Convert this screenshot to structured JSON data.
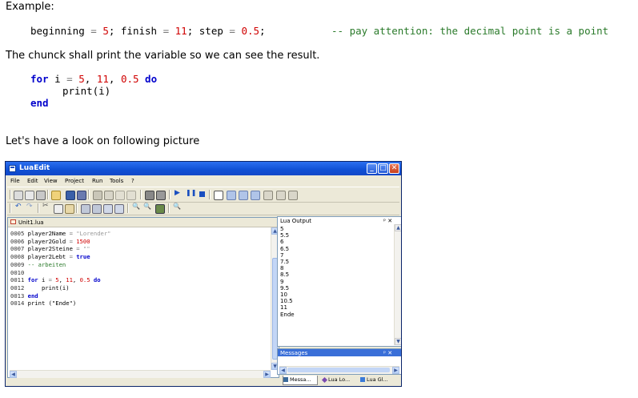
{
  "doc": {
    "example_heading": "Example:",
    "line1": {
      "code_pre1": "beginning ",
      "op1": "=",
      "code_pre2": " ",
      "num1": "5",
      "sep1": "; finish ",
      "op2": "=",
      "sp2": " ",
      "num2": "11",
      "sep2": "; step ",
      "op3": "=",
      "sp3": " ",
      "num3": "0.5",
      "end": ";"
    },
    "line1_comment": "-- pay attention: the decimal point is a point",
    "para": "The chunck shall print the variable so we can see the result.",
    "for_kw": "for",
    "for_var": " i ",
    "for_op": "=",
    "for_sp": " ",
    "for_n1": "5",
    "for_c1": ", ",
    "for_n2": "11",
    "for_c2": ", ",
    "for_n3": "0.5",
    "for_sp2": " ",
    "do_kw": "do",
    "print_line": "print(i)",
    "end_kw": "end",
    "picture_para": "Let's have a look on following picture"
  },
  "window": {
    "title": "LuaEdit",
    "buttons": {
      "min": "_",
      "max": "□",
      "close": "✕"
    },
    "menu": [
      "File",
      "Edit",
      "View",
      "Project",
      "Run",
      "Tools",
      "?"
    ],
    "editor_tab": "Unit1.lua",
    "code": [
      {
        "n": "0005",
        "a": " player2Name ",
        "o": "=",
        "s": " ",
        "v": "\"Lorender\"",
        "t": "str"
      },
      {
        "n": "0006",
        "a": " player2Gold ",
        "o": "=",
        "s": " ",
        "v": "1500",
        "t": "num"
      },
      {
        "n": "0007",
        "a": " player2Steine ",
        "o": "=",
        "s": " ",
        "v": "\"\"",
        "t": "str"
      },
      {
        "n": "0008",
        "a": " player2Lebt ",
        "o": "=",
        "s": " ",
        "v": "true",
        "t": "kw"
      },
      {
        "n": "0009",
        "a": " ",
        "o": "",
        "s": "",
        "v": "-- arbeiten",
        "t": "cmt"
      },
      {
        "n": "0010",
        "a": "",
        "o": "",
        "s": "",
        "v": "",
        "t": "plain"
      },
      {
        "n": "0011",
        "a": " ",
        "o": "",
        "s": "",
        "v": "",
        "t": "for"
      },
      {
        "n": "0012",
        "a": "     print(i)",
        "o": "",
        "s": "",
        "v": "",
        "t": "plain"
      },
      {
        "n": "0013",
        "a": " ",
        "o": "",
        "s": "",
        "v": "end",
        "t": "kw"
      },
      {
        "n": "0014",
        "a": " print (\"Ende\")",
        "o": "",
        "s": "",
        "v": "",
        "t": "plain"
      }
    ],
    "code_for": {
      "kw": "for",
      "mid": " i ",
      "op": "=",
      "sp": " ",
      "n1": "5",
      "c1": ", ",
      "n2": "11",
      "c2": ", ",
      "n3": "0.5",
      "sp2": " ",
      "do": "do"
    },
    "output_title": "Lua Output",
    "output_lines": [
      "5",
      "5.5",
      "6",
      "6.5",
      "7",
      "7.5",
      "8",
      "8.5",
      "9",
      "9.5",
      "10",
      "10.5",
      "11",
      "Ende"
    ],
    "messages_title": "Messages",
    "pin_close": "ᵖ ✕",
    "bottom_tabs": [
      "Messa...",
      "Lua Lo...",
      "Lua Gl..."
    ]
  },
  "colors": {
    "keyword": "#0000cc",
    "number": "#d00000",
    "comment": "#2a7a2a",
    "titlebar": "#0f4fd4"
  }
}
